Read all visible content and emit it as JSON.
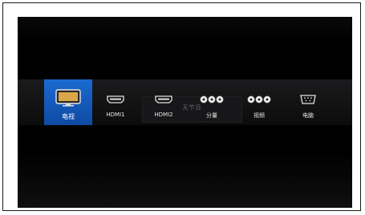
{
  "sources": [
    {
      "id": "tv",
      "label": "电视",
      "icon": "tv-icon",
      "selected": true
    },
    {
      "id": "hdmi1",
      "label": "HDMI1",
      "icon": "hdmi-port-icon",
      "selected": false
    },
    {
      "id": "hdmi2",
      "label": "HDMI2",
      "icon": "hdmi-port-icon",
      "selected": false
    },
    {
      "id": "component",
      "label": "分量",
      "icon": "component-rca-icon",
      "selected": false
    },
    {
      "id": "video",
      "label": "视频",
      "icon": "av-rca-icon",
      "selected": false
    },
    {
      "id": "pc",
      "label": "电脑",
      "icon": "vga-port-icon",
      "selected": false
    }
  ],
  "status": {
    "no_signal": "无节目"
  },
  "colors": {
    "selected": "#1560c4",
    "screen": "#000000"
  }
}
